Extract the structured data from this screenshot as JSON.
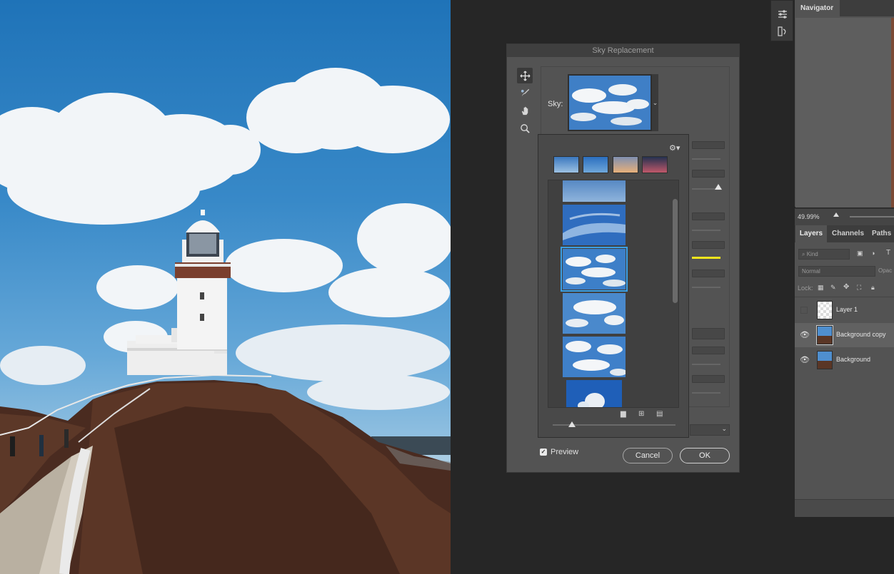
{
  "dialog": {
    "title": "Sky Replacement",
    "sky_label": "Sky:",
    "preview_label": "Preview",
    "preview_checked": true,
    "cancel_label": "Cancel",
    "ok_label": "OK"
  },
  "navigator": {
    "tab": "Navigator",
    "zoom": "49.99%"
  },
  "layers": {
    "tabs": [
      "Layers",
      "Channels",
      "Paths"
    ],
    "filter_placeholder": "Kind",
    "blend_mode": "Normal",
    "opacity_label": "Opac",
    "lock_label": "Lock:",
    "items": [
      {
        "name": "Layer 1",
        "visible": false
      },
      {
        "name": "Background copy",
        "visible": true
      },
      {
        "name": "Background",
        "visible": true
      }
    ]
  },
  "colors": {
    "selection": "#3aa0e8",
    "accent_slider": "#f2e51c",
    "panel": "#535353"
  },
  "icons": [
    "move-icon",
    "sky-brush-icon",
    "hand-icon",
    "zoom-icon",
    "gear-icon",
    "folder-icon",
    "new-icon",
    "trash-icon",
    "eye-icon",
    "cursor-icon"
  ]
}
